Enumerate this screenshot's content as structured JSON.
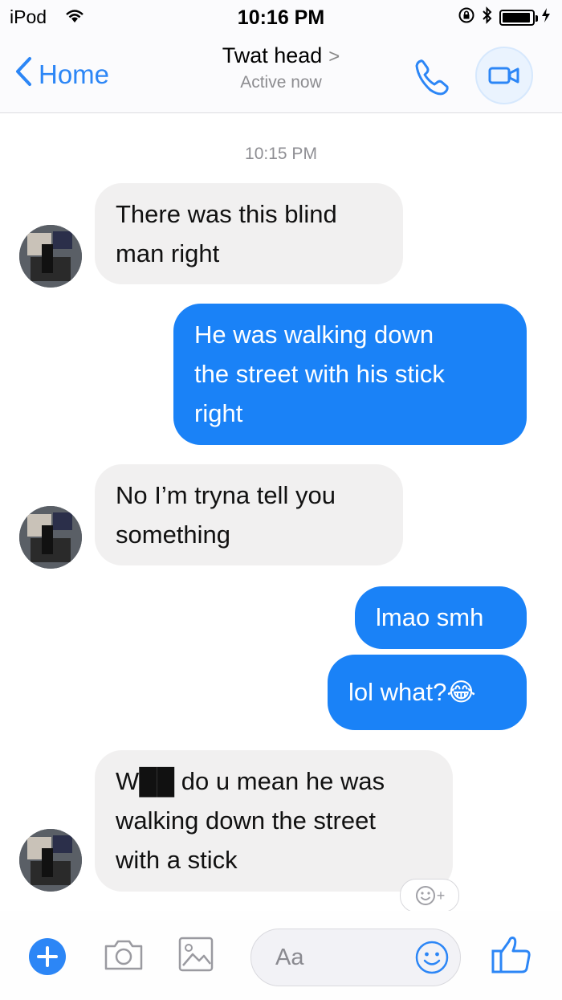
{
  "status_bar": {
    "carrier": "iPod",
    "time": "10:16 PM"
  },
  "header": {
    "back_label": "Home",
    "contact_name": "Twat head",
    "contact_chevron": ">",
    "contact_status": "Active now"
  },
  "chat": {
    "timestamp": "10:15 PM",
    "messages": [
      {
        "sender": "them",
        "text": "There was this blind\nman right"
      },
      {
        "sender": "me",
        "text": "He was walking down\nthe street with his stick\nright"
      },
      {
        "sender": "them",
        "text": "No I’m tryna tell you\nsomething"
      },
      {
        "sender": "me",
        "text": "lmao smh"
      },
      {
        "sender": "me",
        "text": "lol what?😂"
      },
      {
        "sender": "them",
        "text": "W██ do u mean he was\nwalking down the street\nwith a stick"
      }
    ],
    "reaction_label": "+"
  },
  "composer": {
    "placeholder": "Aa"
  },
  "colors": {
    "accent": "#2c86f6",
    "outgoing_bubble": "#1a82f7",
    "incoming_bubble": "#f1f0f0"
  },
  "icons": [
    "wifi-icon",
    "lock-rotation-icon",
    "bluetooth-icon",
    "battery-icon",
    "charging-icon",
    "back-chevron-icon",
    "phone-icon",
    "video-camera-icon",
    "plus-icon",
    "camera-icon",
    "image-icon",
    "emoji-icon",
    "thumbs-up-icon",
    "add-reaction-icon"
  ]
}
